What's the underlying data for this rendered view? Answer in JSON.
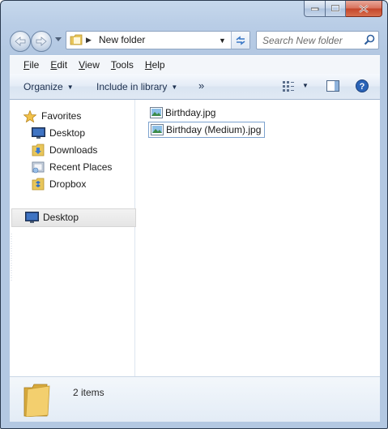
{
  "window": {
    "colors": {
      "frame": "#b9cde6",
      "accent": "#1c2f4e",
      "close": "#c4452a"
    }
  },
  "address": {
    "path": "New folder",
    "icons": {
      "folder": "folder-icon",
      "refresh": "refresh-icon"
    }
  },
  "search": {
    "placeholder": "Search New folder"
  },
  "menu": {
    "file": {
      "accel": "F",
      "rest": "ile"
    },
    "edit": {
      "accel": "E",
      "rest": "dit"
    },
    "view": {
      "accel": "V",
      "rest": "iew"
    },
    "tools": {
      "accel": "T",
      "rest": "ools"
    },
    "help": {
      "accel": "H",
      "rest": "elp"
    }
  },
  "toolbar": {
    "organize": "Organize",
    "include": "Include in library",
    "more": "»"
  },
  "nav": {
    "favorites": "Favorites",
    "items": [
      "Desktop",
      "Downloads",
      "Recent Places",
      "Dropbox"
    ],
    "desktop_root": "Desktop"
  },
  "files": [
    {
      "name": "Birthday.jpg",
      "focused": false
    },
    {
      "name": "Birthday (Medium).jpg",
      "focused": true
    }
  ],
  "details": {
    "count": "2 items"
  }
}
